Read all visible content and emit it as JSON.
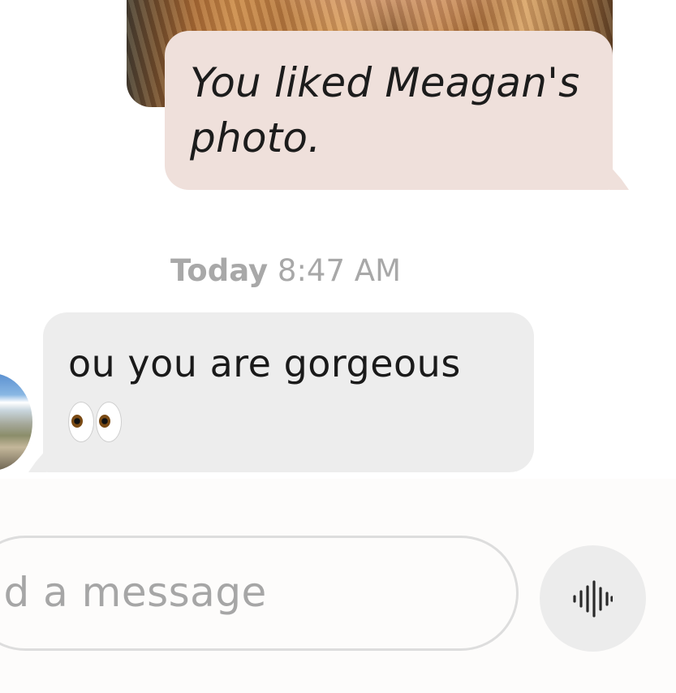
{
  "thread": {
    "sent_reaction": {
      "text": "You liked Meagan's photo."
    },
    "timestamp": {
      "day": "Today",
      "time": "8:47 AM"
    },
    "received_message": {
      "text": "ou you are gorgeous",
      "emoji_icon": "eyes-emoji-icon"
    }
  },
  "composer": {
    "placeholder": "end a message",
    "voice_icon": "waveform-icon"
  },
  "colors": {
    "sent_bubble": "#efe0db",
    "received_bubble": "#ededed",
    "timestamp_text": "#a8a8a8",
    "placeholder_text": "#a6a6a6"
  }
}
